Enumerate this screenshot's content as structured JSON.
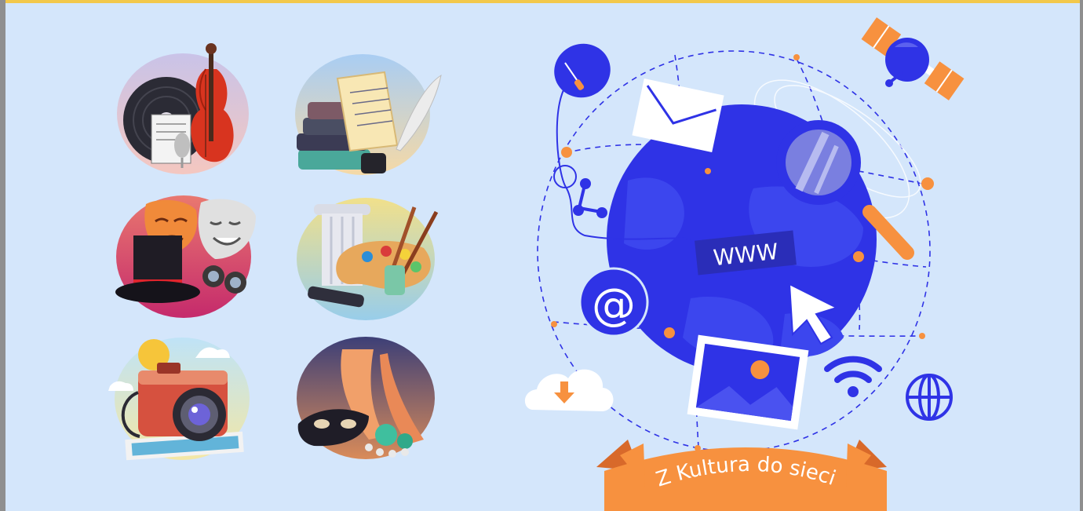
{
  "banner": {
    "text": "Z Kultura do sieci"
  },
  "globe": {
    "www_label": "WWW",
    "at_symbol": "@"
  },
  "icons": [
    "music-icon",
    "literature-icon",
    "theatre-icon",
    "painting-icon",
    "photography-icon",
    "dance-icon",
    "mouse-icon",
    "envelope-icon",
    "magnifier-icon",
    "satellite-icon",
    "share-icon",
    "at-icon",
    "cursor-icon",
    "image-icon",
    "wifi-icon",
    "globe-icon",
    "cloud-download-icon"
  ],
  "colors": {
    "background": "#d4e6fb",
    "primary_blue": "#2f33e6",
    "accent_orange": "#f7913f",
    "top_border": "#f2c84b"
  }
}
